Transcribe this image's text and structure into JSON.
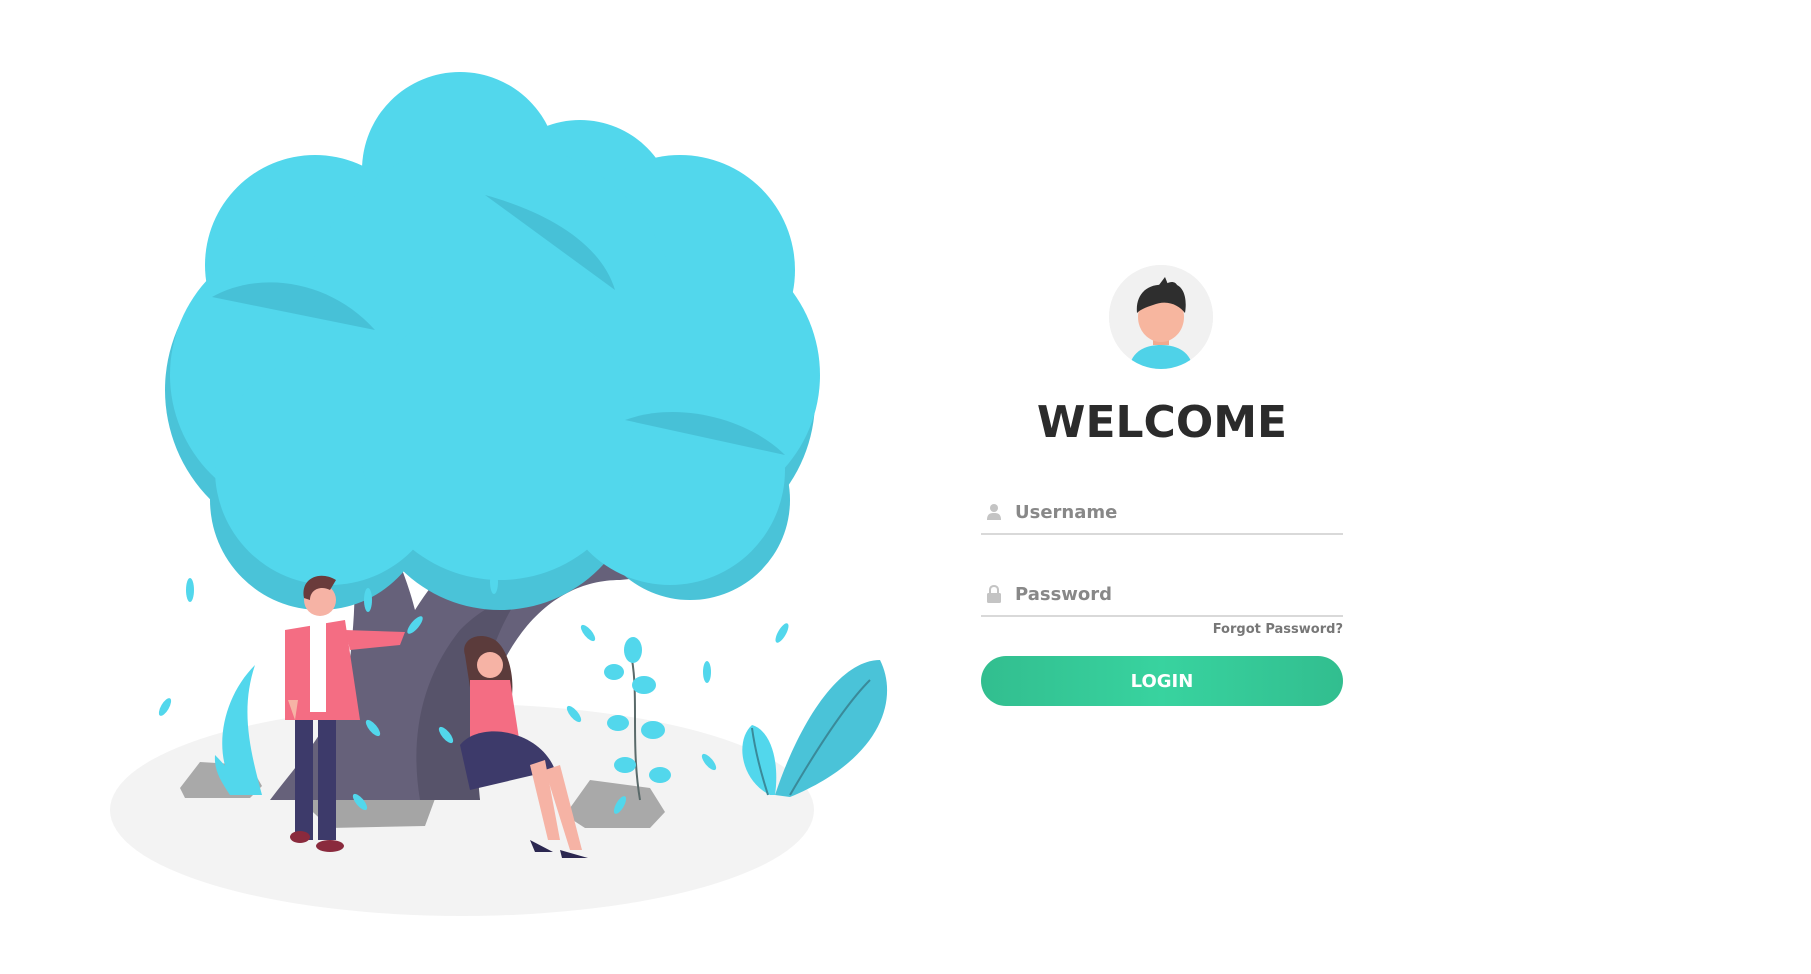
{
  "login": {
    "title": "WELCOME",
    "username_placeholder": "Username",
    "password_placeholder": "Password",
    "forgot_password": "Forgot Password?",
    "submit_label": "LOGIN"
  },
  "icons": {
    "avatar": "user-avatar-icon",
    "username": "user-icon",
    "password": "lock-icon"
  },
  "colors": {
    "tree_foliage": "#52d7ec",
    "tree_trunk": "#6a6478",
    "button_green": "#38d39f",
    "title_text": "#2b2b2b",
    "field_line": "#d9d9d9",
    "ground": "#f3f3f3"
  }
}
